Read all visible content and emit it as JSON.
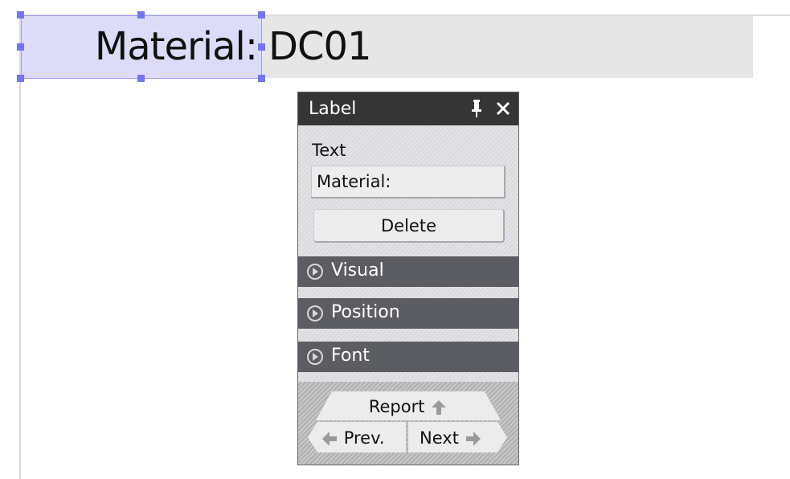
{
  "canvas": {
    "label_text": "Material:",
    "value_text": "DC01"
  },
  "panel": {
    "title": "Label",
    "text_field_label": "Text",
    "text_value": "Material:",
    "delete_label": "Delete",
    "sections": [
      "Visual",
      "Position",
      "Font"
    ],
    "nav": {
      "report_label": "Report",
      "prev_label": "Prev.",
      "next_label": "Next"
    }
  },
  "icons": [
    "pin-icon",
    "close-icon",
    "expand-circle-icon",
    "arrow-up-icon",
    "arrow-left-icon",
    "arrow-right-icon"
  ],
  "colors": {
    "selection_fill": "#dcdcf8",
    "handle": "#7474f2",
    "panel_header": "#353535",
    "section_header": "#5c5d62",
    "field_bg": "#e6e6e6"
  }
}
